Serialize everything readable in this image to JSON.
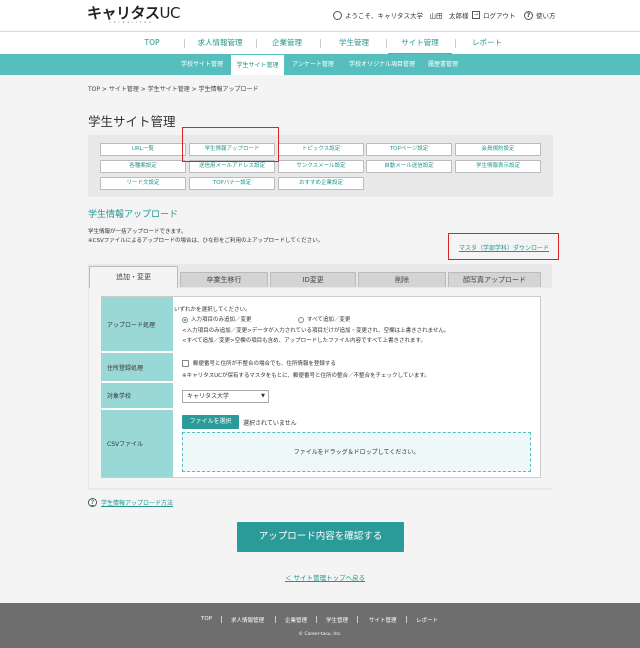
{
  "header": {
    "logo_main": "キャリタス",
    "logo_uc": "UC",
    "logo_sub": "c a r e e r i t a s",
    "welcome": "ようこそ、キャリタス大学　山田　太郎様",
    "logout": "ログアウト",
    "help": "使い方",
    "logout_icon": "logout-icon",
    "help_icon": "question-circle-icon",
    "user_icon": "user-icon"
  },
  "main_nav": {
    "items": [
      "TOP",
      "求人情報管理",
      "企業管理",
      "学生管理",
      "サイト管理",
      "レポート"
    ],
    "active": "サイト管理"
  },
  "sub_nav": {
    "items": [
      "学校サイト管理",
      "学生サイト管理",
      "アンケート管理",
      "学校オリジナル項目管理",
      "履歴書管理"
    ],
    "active": "学生サイト管理"
  },
  "breadcrumb": "TOP > サイト管理 > 学生サイト管理 > 学生情報アップロード",
  "page_title": "学生サイト管理",
  "menu": {
    "row1": [
      "URL一覧",
      "学生情報アップロード",
      "トピックス設定",
      "TOPページ設定",
      "会員規約設定"
    ],
    "row2": [
      "各種案設定",
      "送信用メールアドレス設定",
      "サンクスメール設定",
      "自動メール送信設定",
      "学生情報表示設定"
    ],
    "row3": [
      "リード文設定",
      "TOPバナー設定",
      "おすすめ企業設定"
    ]
  },
  "section": {
    "title": "学生情報アップロード",
    "desc1": "学生情報が一括アップロードできます。",
    "desc2": "※CSVファイルによるアップロードの場合は、ひな形をご利用の上アップロードしてください。",
    "download_link": "マスタ（学部学科）ダウンロード"
  },
  "tabs": [
    "追加・変更",
    "卒業生移行",
    "ID変更",
    "削除",
    "顔写真アップロード"
  ],
  "form": {
    "upload_label": "アップロード処理",
    "upload_prompt": "いずれかを選択してください。",
    "radio1": "入力項目のみ追加／変更",
    "radio2": "すべて追加／変更",
    "radio_selected": "入力項目のみ追加／変更",
    "note1": "<入力項目のみ追加／変更>データが入力されている項目だけが追加・変更され、空欄は上書きされません。",
    "note2": "<すべて追加／変更>空欄の項目も含め、アップロードしたファイル内容ですべて上書きされます。",
    "address_label": "住所登録処理",
    "address_check": "郵便番号と住所が不整合の場合でも、住所情報を登録する",
    "address_checked": false,
    "address_note": "※キャリタスUCが保有するマスタをもとに、郵便番号と住所の整合／不整合をチェックしています。",
    "school_label": "対象学校",
    "school_value": "キャリタス大学",
    "csv_label": "CSVファイル",
    "file_button": "ファイルを選択",
    "file_status": "選択されていません",
    "drop_text": "ファイルをドラッグ＆ドロップしてください。"
  },
  "help_link": "学生情報アップロード方法",
  "confirm_button": "アップロード内容を確認する",
  "back_link": "＜ サイト管理トップへ戻る",
  "footer": {
    "items": [
      "TOP",
      "求人情報管理",
      "企業管理",
      "学生管理",
      "サイト管理",
      "レポート"
    ],
    "copyright": "© Career-tasu, Inc."
  },
  "colors": {
    "accent": "#23958e",
    "subnav": "#56bfbd",
    "label_bg": "#9ad8d6",
    "highlight_red": "#d9232b",
    "footer": "#6e6e6e"
  }
}
